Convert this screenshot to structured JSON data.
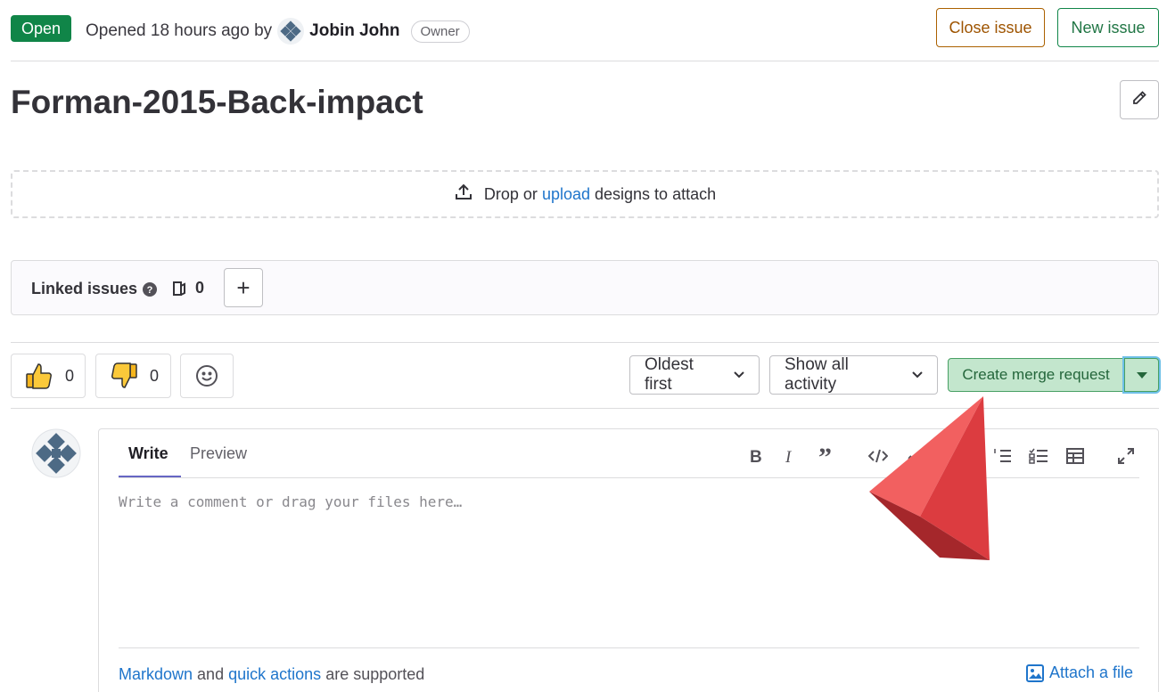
{
  "header": {
    "status": "Open",
    "opened_prefix": "Opened 18 hours ago by",
    "author": "Jobin John",
    "role_badge": "Owner",
    "close_issue": "Close issue",
    "new_issue": "New issue"
  },
  "issue": {
    "title": "Forman-2015-Back-impact"
  },
  "designs": {
    "prefix": "Drop or",
    "link": "upload",
    "suffix": "designs to attach"
  },
  "linked_issues": {
    "label": "Linked issues",
    "count": "0"
  },
  "reactions": {
    "thumbs_up_count": "0",
    "thumbs_down_count": "0"
  },
  "activity": {
    "sort_label": "Oldest first",
    "filter_label": "Show all activity",
    "create_merge_request": "Create merge request"
  },
  "comment": {
    "tab_write": "Write",
    "tab_preview": "Preview",
    "placeholder": "Write a comment or drag your files here…",
    "footer_link_markdown": "Markdown",
    "footer_and": "and",
    "footer_link_quick": "quick actions",
    "footer_suffix": "are supported",
    "attach_file": "Attach a file"
  },
  "colors": {
    "status_green": "#108548",
    "link_blue": "#1f75cb",
    "close_orange": "#ab6100",
    "merge_green_bg": "#c3e6cd"
  }
}
